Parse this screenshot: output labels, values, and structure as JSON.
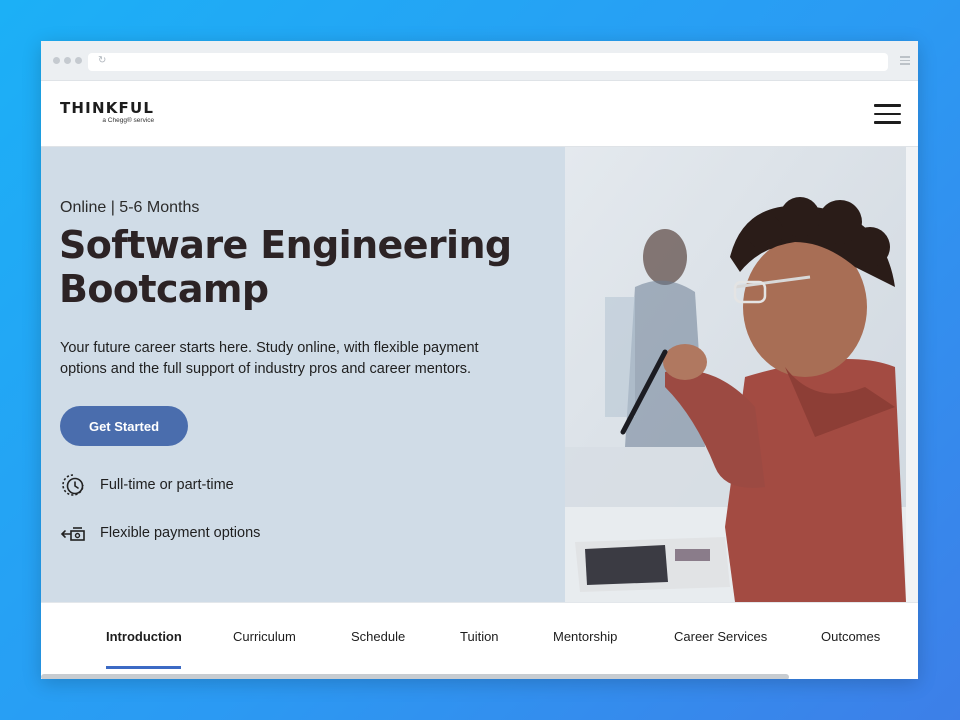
{
  "brand": {
    "name": "THINKFUL",
    "tagline": "a Chegg® service"
  },
  "header": {
    "menu_icon": "hamburger-icon"
  },
  "hero": {
    "eyebrow": "Online | 5-6 Months",
    "title": "Software Engineering Bootcamp",
    "description": "Your future career starts here. Study online, with flexible payment options and the full support of industry pros and career mentors.",
    "cta_label": "Get Started",
    "features": [
      {
        "icon": "clock-icon",
        "label": "Full-time or part-time"
      },
      {
        "icon": "payment-icon",
        "label": "Flexible payment options"
      }
    ]
  },
  "tabs": [
    {
      "label": "Introduction",
      "active": true
    },
    {
      "label": "Curriculum"
    },
    {
      "label": "Schedule"
    },
    {
      "label": "Tuition"
    },
    {
      "label": "Mentorship"
    },
    {
      "label": "Career Services"
    },
    {
      "label": "Outcomes"
    }
  ],
  "colors": {
    "background": "#1cb0f6",
    "hero_bg": "#d0dce7",
    "cta": "#4a6dad",
    "active_tab_underline": "#3c6ac4",
    "title_text": "#2c2325"
  }
}
